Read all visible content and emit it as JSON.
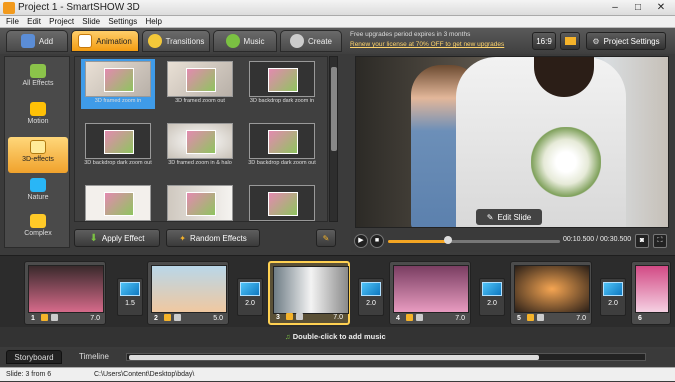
{
  "window": {
    "title": "Project 1 - SmartSHOW 3D",
    "controls": [
      "–",
      "□",
      "✕"
    ]
  },
  "menu": [
    "File",
    "Edit",
    "Project",
    "Slide",
    "Settings",
    "Help"
  ],
  "tabs": [
    {
      "label": "Add",
      "color": "#5b8dd6"
    },
    {
      "label": "Animation",
      "color": "#ffffff"
    },
    {
      "label": "Transitions",
      "color": "#f3c83a"
    },
    {
      "label": "Music",
      "color": "#7bc142"
    },
    {
      "label": "Create",
      "color": "#cccccc"
    }
  ],
  "license": {
    "line1": "Free upgrades period expires in 3 months",
    "line2": "Renew your license at 70% OFF to get new upgrades"
  },
  "aspect": "16:9",
  "project_settings": "Project Settings",
  "categories": [
    {
      "label": "All Effects",
      "color": "#8bc34a"
    },
    {
      "label": "Motion",
      "color": "#ffc107"
    },
    {
      "label": "3D-effects",
      "color": "#ffb300"
    },
    {
      "label": "Nature",
      "color": "#29b6f6"
    },
    {
      "label": "Complex",
      "color": "#ffca28"
    }
  ],
  "effects": [
    "3D framed zoom in",
    "3D framed zoom out",
    "3D backdrop dark zoom in",
    "3D backdrop dark zoom out",
    "3D framed zoom in & halo",
    "3D backdrop dark zoom out",
    "",
    "",
    ""
  ],
  "apply_effect": "Apply Effect",
  "random_effects": "Random Effects",
  "edit_slide": "Edit Slide",
  "time": {
    "current": "00:10.500",
    "total": "00:30.500",
    "separator": "/",
    "progress": 0.35
  },
  "slides": [
    {
      "num": "1",
      "dur": "7.0",
      "colors": [
        "#3a2a2c",
        "#d66a8a"
      ]
    },
    {
      "num": "2",
      "dur": "5.0",
      "colors": [
        "#b9d7e9",
        "#f0c8a0"
      ]
    },
    {
      "num": "3",
      "dur": "7.0",
      "colors": [
        "#6f7d86",
        "#f3f3f3"
      ]
    },
    {
      "num": "4",
      "dur": "7.0",
      "colors": [
        "#7a3e62",
        "#e89bc0"
      ]
    },
    {
      "num": "5",
      "dur": "7.0",
      "colors": [
        "#2a1f18",
        "#f5a552"
      ]
    },
    {
      "num": "6",
      "dur": "",
      "colors": [
        "#d24a85",
        "#f5d0e2"
      ]
    }
  ],
  "transitions": [
    "1.5",
    "2.0",
    "2.0",
    "2.0",
    "2.0"
  ],
  "music_hint": "Double-click to add music",
  "bottom_tabs": [
    "Storyboard",
    "Timeline"
  ],
  "status": {
    "slide": "Slide: 3 from 6",
    "path": "C:\\Users\\Content\\Desktop\\bday\\"
  }
}
